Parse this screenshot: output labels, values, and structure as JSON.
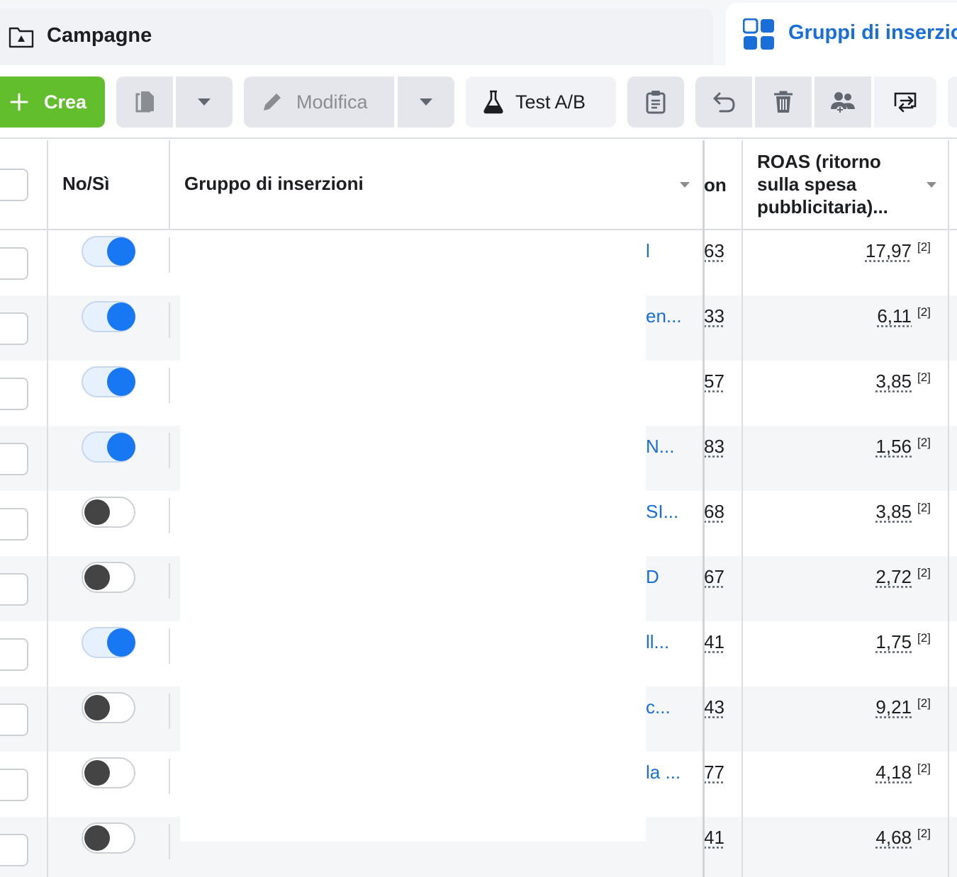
{
  "tabs": {
    "campaigns": "Campagne",
    "adsets": "Gruppi di inserzioni"
  },
  "toolbar": {
    "create": "Crea",
    "edit": "Modifica",
    "ab_test": "Test A/B"
  },
  "table": {
    "headers": {
      "onoff": "No/Sì",
      "adset": "Gruppo di inserzioni",
      "truncated": "on",
      "roas": "ROAS (ritorno sulla spesa pubblicitaria)..."
    },
    "rows": [
      {
        "on": true,
        "name": "l",
        "col": "63",
        "roas": "17,97",
        "note": "[2]"
      },
      {
        "on": true,
        "name": "en...",
        "col": "33",
        "roas": "6,11",
        "note": "[2]"
      },
      {
        "on": true,
        "name": "",
        "col": "57",
        "roas": "3,85",
        "note": "[2]"
      },
      {
        "on": true,
        "name": "N...",
        "col": "83",
        "roas": "1,56",
        "note": "[2]"
      },
      {
        "on": false,
        "name": "SI...",
        "col": "68",
        "roas": "3,85",
        "note": "[2]"
      },
      {
        "on": false,
        "name": "D",
        "col": "67",
        "roas": "2,72",
        "note": "[2]"
      },
      {
        "on": true,
        "name": "ll...",
        "col": "41",
        "roas": "1,75",
        "note": "[2]"
      },
      {
        "on": false,
        "name": "c...",
        "col": "43",
        "roas": "9,21",
        "note": "[2]"
      },
      {
        "on": false,
        "name": "la ...",
        "col": "77",
        "roas": "4,18",
        "note": "[2]"
      },
      {
        "on": false,
        "name": "",
        "col": "41",
        "roas": "4,68",
        "note": "[2]"
      }
    ]
  },
  "colors": {
    "accent": "#1a6ed8",
    "create_green": "#63be2d",
    "toggle_on": "#1877f2"
  }
}
